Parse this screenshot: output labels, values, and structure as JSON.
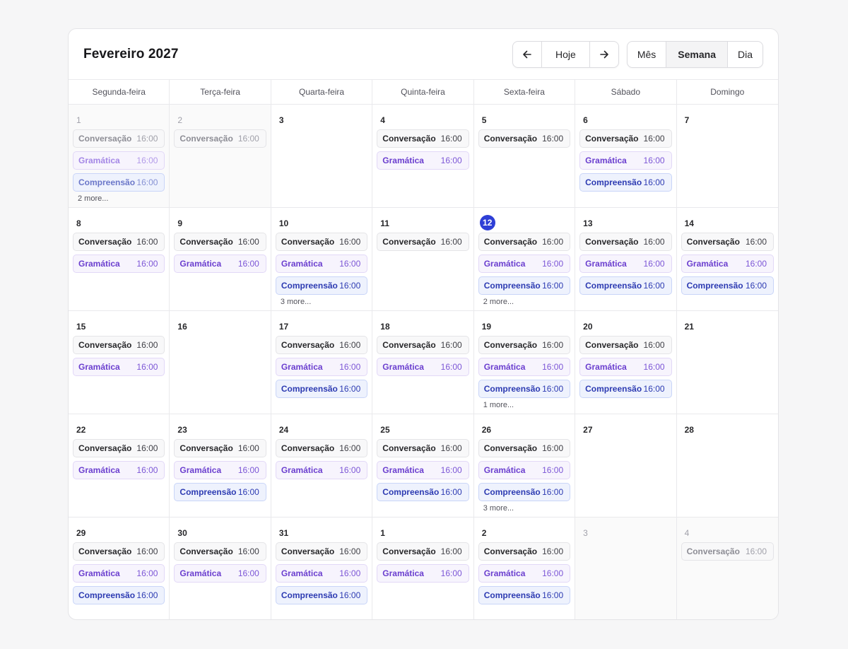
{
  "header": {
    "title": "Fevereiro 2027"
  },
  "nav": {
    "prev_icon": "arrow-left-icon",
    "today_label": "Hoje",
    "next_icon": "arrow-right-icon"
  },
  "views": [
    {
      "label": "Mês",
      "active": false
    },
    {
      "label": "Semana",
      "active": true
    },
    {
      "label": "Dia",
      "active": false
    }
  ],
  "weekdays": [
    "Segunda-feira",
    "Terça-feira",
    "Quarta-feira",
    "Quinta-feira",
    "Sexta-feira",
    "Sábado",
    "Domingo"
  ],
  "event_types": {
    "conv": {
      "name": "Conversação",
      "color": "#27272a"
    },
    "gram": {
      "name": "Gramática",
      "color": "#6b3fcf"
    },
    "comp": {
      "name": "Compreensão",
      "color": "#2d3bb2"
    }
  },
  "days": [
    {
      "num": "1",
      "outside": true,
      "events": [
        {
          "type": "conv",
          "name": "Conversação",
          "time": "16:00"
        },
        {
          "type": "gram",
          "name": "Gramática",
          "time": "16:00"
        },
        {
          "type": "comp",
          "name": "Compreensão",
          "time": "16:00"
        }
      ],
      "more": "2 more..."
    },
    {
      "num": "2",
      "outside": true,
      "events": [
        {
          "type": "conv",
          "name": "Conversação",
          "time": "16:00"
        }
      ]
    },
    {
      "num": "3",
      "events": []
    },
    {
      "num": "4",
      "events": [
        {
          "type": "conv",
          "name": "Conversação",
          "time": "16:00"
        },
        {
          "type": "gram",
          "name": "Gramática",
          "time": "16:00"
        }
      ]
    },
    {
      "num": "5",
      "events": [
        {
          "type": "conv",
          "name": "Conversação",
          "time": "16:00"
        }
      ]
    },
    {
      "num": "6",
      "events": [
        {
          "type": "conv",
          "name": "Conversação",
          "time": "16:00"
        },
        {
          "type": "gram",
          "name": "Gramática",
          "time": "16:00"
        },
        {
          "type": "comp",
          "name": "Compreensão",
          "time": "16:00"
        }
      ]
    },
    {
      "num": "7",
      "events": []
    },
    {
      "num": "8",
      "events": [
        {
          "type": "conv",
          "name": "Conversação",
          "time": "16:00"
        },
        {
          "type": "gram",
          "name": "Gramática",
          "time": "16:00"
        }
      ]
    },
    {
      "num": "9",
      "events": [
        {
          "type": "conv",
          "name": "Conversação",
          "time": "16:00"
        },
        {
          "type": "gram",
          "name": "Gramática",
          "time": "16:00"
        }
      ]
    },
    {
      "num": "10",
      "events": [
        {
          "type": "conv",
          "name": "Conversação",
          "time": "16:00"
        },
        {
          "type": "gram",
          "name": "Gramática",
          "time": "16:00"
        },
        {
          "type": "comp",
          "name": "Compreensão",
          "time": "16:00"
        }
      ],
      "more": "3 more..."
    },
    {
      "num": "11",
      "events": [
        {
          "type": "conv",
          "name": "Conversação",
          "time": "16:00"
        }
      ]
    },
    {
      "num": "12",
      "today": true,
      "events": [
        {
          "type": "conv",
          "name": "Conversação",
          "time": "16:00"
        },
        {
          "type": "gram",
          "name": "Gramática",
          "time": "16:00"
        },
        {
          "type": "comp",
          "name": "Compreensão",
          "time": "16:00"
        }
      ],
      "more": "2 more..."
    },
    {
      "num": "13",
      "events": [
        {
          "type": "conv",
          "name": "Conversação",
          "time": "16:00"
        },
        {
          "type": "gram",
          "name": "Gramática",
          "time": "16:00"
        },
        {
          "type": "comp",
          "name": "Compreensão",
          "time": "16:00"
        }
      ]
    },
    {
      "num": "14",
      "events": [
        {
          "type": "conv",
          "name": "Conversação",
          "time": "16:00"
        },
        {
          "type": "gram",
          "name": "Gramática",
          "time": "16:00"
        },
        {
          "type": "comp",
          "name": "Compreensão",
          "time": "16:00"
        }
      ]
    },
    {
      "num": "15",
      "events": [
        {
          "type": "conv",
          "name": "Conversação",
          "time": "16:00"
        },
        {
          "type": "gram",
          "name": "Gramática",
          "time": "16:00"
        }
      ]
    },
    {
      "num": "16",
      "events": []
    },
    {
      "num": "17",
      "events": [
        {
          "type": "conv",
          "name": "Conversação",
          "time": "16:00"
        },
        {
          "type": "gram",
          "name": "Gramática",
          "time": "16:00"
        },
        {
          "type": "comp",
          "name": "Compreensão",
          "time": "16:00"
        }
      ]
    },
    {
      "num": "18",
      "events": [
        {
          "type": "conv",
          "name": "Conversação",
          "time": "16:00"
        },
        {
          "type": "gram",
          "name": "Gramática",
          "time": "16:00"
        }
      ]
    },
    {
      "num": "19",
      "events": [
        {
          "type": "conv",
          "name": "Conversação",
          "time": "16:00"
        },
        {
          "type": "gram",
          "name": "Gramática",
          "time": "16:00"
        },
        {
          "type": "comp",
          "name": "Compreensão",
          "time": "16:00"
        }
      ],
      "more": "1 more..."
    },
    {
      "num": "20",
      "events": [
        {
          "type": "conv",
          "name": "Conversação",
          "time": "16:00"
        },
        {
          "type": "gram",
          "name": "Gramática",
          "time": "16:00"
        },
        {
          "type": "comp",
          "name": "Compreensão",
          "time": "16:00"
        }
      ]
    },
    {
      "num": "21",
      "events": []
    },
    {
      "num": "22",
      "events": [
        {
          "type": "conv",
          "name": "Conversação",
          "time": "16:00"
        },
        {
          "type": "gram",
          "name": "Gramática",
          "time": "16:00"
        }
      ]
    },
    {
      "num": "23",
      "events": [
        {
          "type": "conv",
          "name": "Conversação",
          "time": "16:00"
        },
        {
          "type": "gram",
          "name": "Gramática",
          "time": "16:00"
        },
        {
          "type": "comp",
          "name": "Compreensão",
          "time": "16:00"
        }
      ]
    },
    {
      "num": "24",
      "events": [
        {
          "type": "conv",
          "name": "Conversação",
          "time": "16:00"
        },
        {
          "type": "gram",
          "name": "Gramática",
          "time": "16:00"
        }
      ]
    },
    {
      "num": "25",
      "events": [
        {
          "type": "conv",
          "name": "Conversação",
          "time": "16:00"
        },
        {
          "type": "gram",
          "name": "Gramática",
          "time": "16:00"
        },
        {
          "type": "comp",
          "name": "Compreensão",
          "time": "16:00"
        }
      ]
    },
    {
      "num": "26",
      "events": [
        {
          "type": "conv",
          "name": "Conversação",
          "time": "16:00"
        },
        {
          "type": "gram",
          "name": "Gramática",
          "time": "16:00"
        },
        {
          "type": "comp",
          "name": "Compreensão",
          "time": "16:00"
        }
      ],
      "more": "3 more..."
    },
    {
      "num": "27",
      "events": []
    },
    {
      "num": "28",
      "events": []
    },
    {
      "num": "29",
      "events": [
        {
          "type": "conv",
          "name": "Conversação",
          "time": "16:00"
        },
        {
          "type": "gram",
          "name": "Gramática",
          "time": "16:00"
        },
        {
          "type": "comp",
          "name": "Compreensão",
          "time": "16:00"
        }
      ]
    },
    {
      "num": "30",
      "events": [
        {
          "type": "conv",
          "name": "Conversação",
          "time": "16:00"
        },
        {
          "type": "gram",
          "name": "Gramática",
          "time": "16:00"
        }
      ]
    },
    {
      "num": "31",
      "events": [
        {
          "type": "conv",
          "name": "Conversação",
          "time": "16:00"
        },
        {
          "type": "gram",
          "name": "Gramática",
          "time": "16:00"
        },
        {
          "type": "comp",
          "name": "Compreensão",
          "time": "16:00"
        }
      ]
    },
    {
      "num": "1",
      "events": [
        {
          "type": "conv",
          "name": "Conversação",
          "time": "16:00"
        },
        {
          "type": "gram",
          "name": "Gramática",
          "time": "16:00"
        }
      ]
    },
    {
      "num": "2",
      "events": [
        {
          "type": "conv",
          "name": "Conversação",
          "time": "16:00"
        },
        {
          "type": "gram",
          "name": "Gramática",
          "time": "16:00"
        },
        {
          "type": "comp",
          "name": "Compreensão",
          "time": "16:00"
        }
      ]
    },
    {
      "num": "3",
      "outside": true,
      "events": []
    },
    {
      "num": "4",
      "outside": true,
      "events": [
        {
          "type": "conv",
          "name": "Conversação",
          "time": "16:00"
        }
      ]
    }
  ]
}
